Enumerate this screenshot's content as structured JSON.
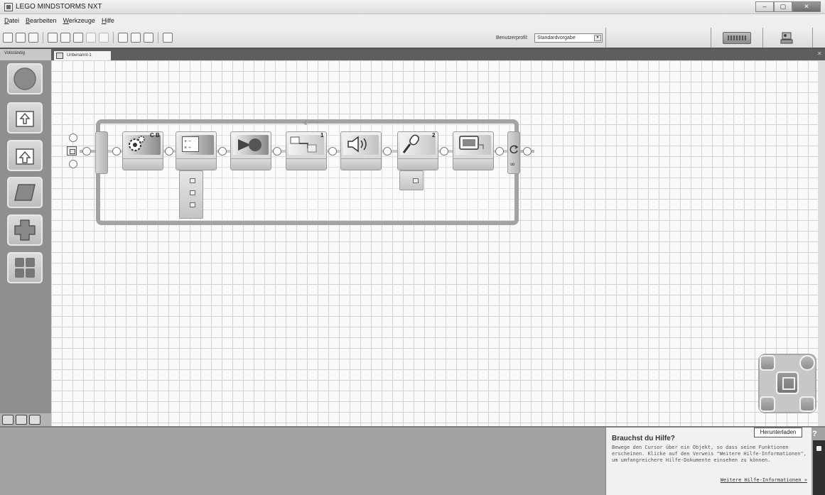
{
  "window": {
    "title": "LEGO MINDSTORMS NXT"
  },
  "menu": {
    "items": [
      {
        "prefix": "",
        "accel": "D",
        "rest": "atei"
      },
      {
        "prefix": "",
        "accel": "B",
        "rest": "earbeiten"
      },
      {
        "prefix": "",
        "accel": "W",
        "rest": "erkzeuge"
      },
      {
        "prefix": "",
        "accel": "H",
        "rest": "ilfe"
      }
    ]
  },
  "toolbar": {
    "profile_label": "Benutzerprofil:",
    "profile_value": "Standardvorgabe"
  },
  "palette": {
    "tab_label": "Vollständig",
    "items": [
      "common-blocks",
      "action-blocks",
      "sensor-blocks",
      "flow-blocks",
      "data-blocks",
      "advanced-blocks"
    ]
  },
  "document": {
    "tab_label": "Unbenannt-1"
  },
  "program": {
    "blocks": [
      {
        "name": "move",
        "label": "C B"
      },
      {
        "name": "math",
        "label": ""
      },
      {
        "name": "send-message",
        "label": ""
      },
      {
        "name": "compare",
        "label": "1"
      },
      {
        "name": "sound",
        "label": ""
      },
      {
        "name": "record-play",
        "label": "2"
      },
      {
        "name": "display",
        "label": ""
      }
    ],
    "loop_symbol": "∞"
  },
  "help": {
    "title": "Brauchst du Hilfe?",
    "body": "Bewege den Cursor über ein Objekt, so dass seine Funktionen erscheinen. Klicke auf den Verweis \"Weitere Hilfe-Informationen\", um umfangreichere Hilfe-Dokumente einsehen zu können.",
    "link": "Weitere Hilfe-Informationen »",
    "download": "Herunterladen",
    "question_mark": "?"
  },
  "colors": {
    "frame": "#5e5e5e",
    "canvas": "#fafafa",
    "grid": "#d3d3d3"
  }
}
